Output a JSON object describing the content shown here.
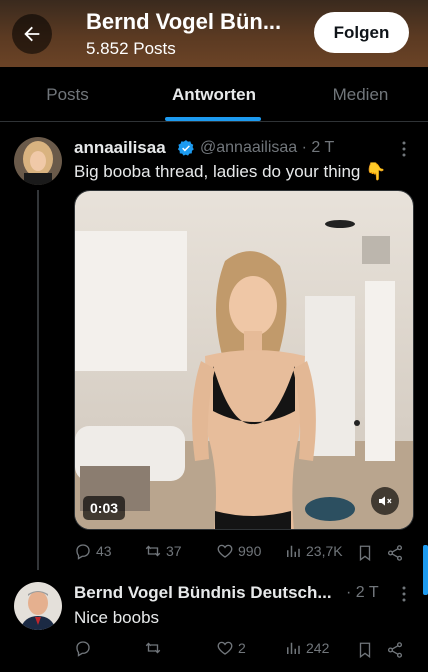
{
  "header": {
    "title": "Bernd Vogel Bün...",
    "subtitle": "5.852 Posts",
    "follow_label": "Folgen"
  },
  "tabs": [
    {
      "label": "Posts",
      "active": false
    },
    {
      "label": "Antworten",
      "active": true
    },
    {
      "label": "Medien",
      "active": false
    }
  ],
  "accent_color": "#1d9bf0",
  "tweet1": {
    "name": "annaailisaa",
    "verified": true,
    "handle": "@annaailisaa",
    "time": "· 2 T",
    "text": "Big booba thread, ladies do your thing 👇",
    "video_time": "0:03",
    "actions": {
      "replies": "43",
      "reposts": "37",
      "likes": "990",
      "views": "23,7K"
    }
  },
  "tweet2": {
    "name": "Bernd Vogel Bündnis Deutsch...",
    "time": "· 2 T",
    "text": "Nice boobs",
    "actions": {
      "replies": "",
      "reposts": "",
      "likes": "2",
      "views": "242"
    }
  }
}
